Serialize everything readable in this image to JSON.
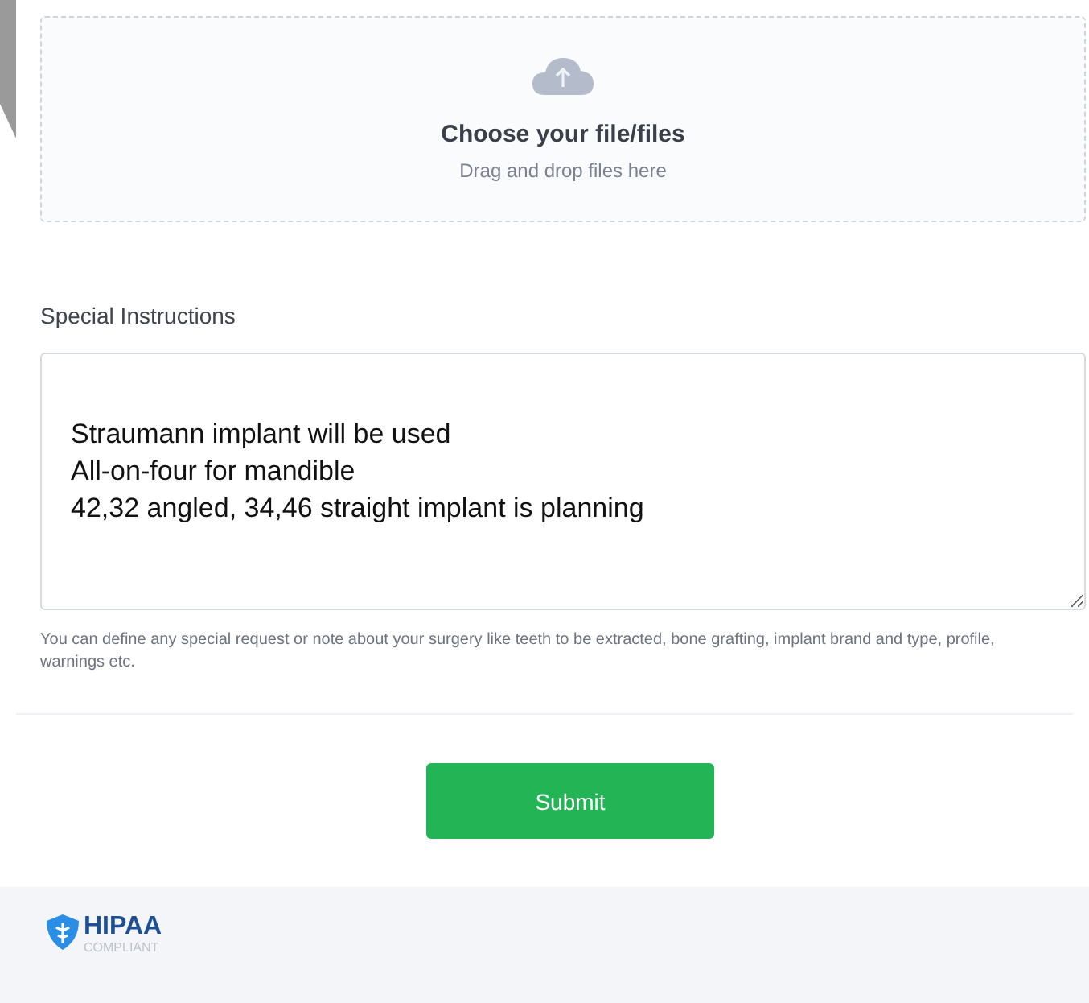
{
  "upload": {
    "title": "Choose your file/files",
    "hint": "Drag and drop files here"
  },
  "instructions": {
    "label": "Special Instructions",
    "value": "Straumann implant will be used\nAll-on-four for mandible\n42,32 angled, 34,46 straight implant is planning",
    "help": "You can define any special request or note about your surgery like teeth to be extracted, bone grafting, implant brand and type, profile, warnings etc."
  },
  "submit": {
    "label": "Submit"
  },
  "footer": {
    "badge_title": "HIPAA",
    "badge_subtitle": "COMPLIANT"
  }
}
